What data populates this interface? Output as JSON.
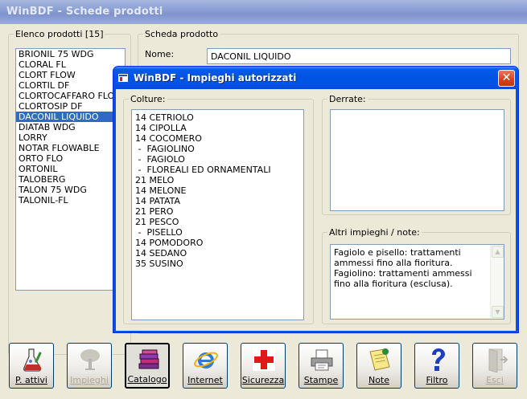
{
  "app": {
    "title": "WinBDF - Schede prodotti"
  },
  "product_list": {
    "legend": "Elenco prodotti [15]",
    "items": [
      "BRIONIL 75 WDG",
      "CLORAL FL",
      "CLORT FLOW",
      "CLORTIL DF",
      "CLORTOCAFFARO FLOW",
      "CLORTOSIP DF",
      "DACONIL LIQUIDO",
      "DIATAB WDG",
      "LORRY",
      "NOTAR FLOWABLE",
      "ORTO FLO",
      "ORTONIL",
      "TALOBERG",
      "TALON 75 WDG",
      "TALONIL-FL"
    ],
    "selected_index": 6
  },
  "product_card": {
    "legend": "Scheda prodotto",
    "name_label": "Nome:",
    "name_value": "DACONIL LIQUIDO"
  },
  "dialog": {
    "title": "WinBDF - Impieghi autorizzati",
    "close_symbol": "✕",
    "colture": {
      "legend": "Colture:",
      "items": [
        "14 CETRIOLO",
        "14 CIPOLLA",
        "14 COCOMERO",
        " -  FAGIOLINO",
        " -  FAGIOLO",
        " -  FLOREALI ED ORNAMENTALI",
        "21 MELO",
        "14 MELONE",
        "14 PATATA",
        "21 PERO",
        "21 PESCO",
        " -  PISELLO",
        "14 POMODORO",
        "14 SEDANO",
        "35 SUSINO"
      ]
    },
    "derrate": {
      "legend": "Derrate:"
    },
    "notes": {
      "legend": "Altri impieghi / note:",
      "text": "Fagiolo e pisello: trattamenti ammessi fino alla fioritura. Fagiolino: trattamenti ammessi fino alla fioritura (esclusa)."
    }
  },
  "toolbar": {
    "buttons": [
      {
        "label": "P. attivi",
        "icon": "flask-icon",
        "enabled": true,
        "pressed": false
      },
      {
        "label": "Impieghi",
        "icon": "tree-icon",
        "enabled": false,
        "pressed": false
      },
      {
        "label": "Catalogo",
        "icon": "books-icon",
        "enabled": true,
        "pressed": true
      },
      {
        "label": "Internet",
        "icon": "internet-explorer-icon",
        "enabled": true,
        "pressed": false
      },
      {
        "label": "Sicurezza",
        "icon": "red-cross-icon",
        "enabled": true,
        "pressed": false
      },
      {
        "label": "Stampe",
        "icon": "printer-icon",
        "enabled": true,
        "pressed": false
      },
      {
        "label": "Note",
        "icon": "notepad-icon",
        "enabled": true,
        "pressed": false
      },
      {
        "label": "Filtro",
        "icon": "question-mark-icon",
        "enabled": true,
        "pressed": false
      },
      {
        "label": "Esci",
        "icon": "exit-door-icon",
        "enabled": false,
        "pressed": false
      }
    ]
  },
  "colors": {
    "selection": "#316ac5",
    "title_active": "#0054e3",
    "title_inactive": "#8a9fd4",
    "close_button": "#d5401c"
  }
}
